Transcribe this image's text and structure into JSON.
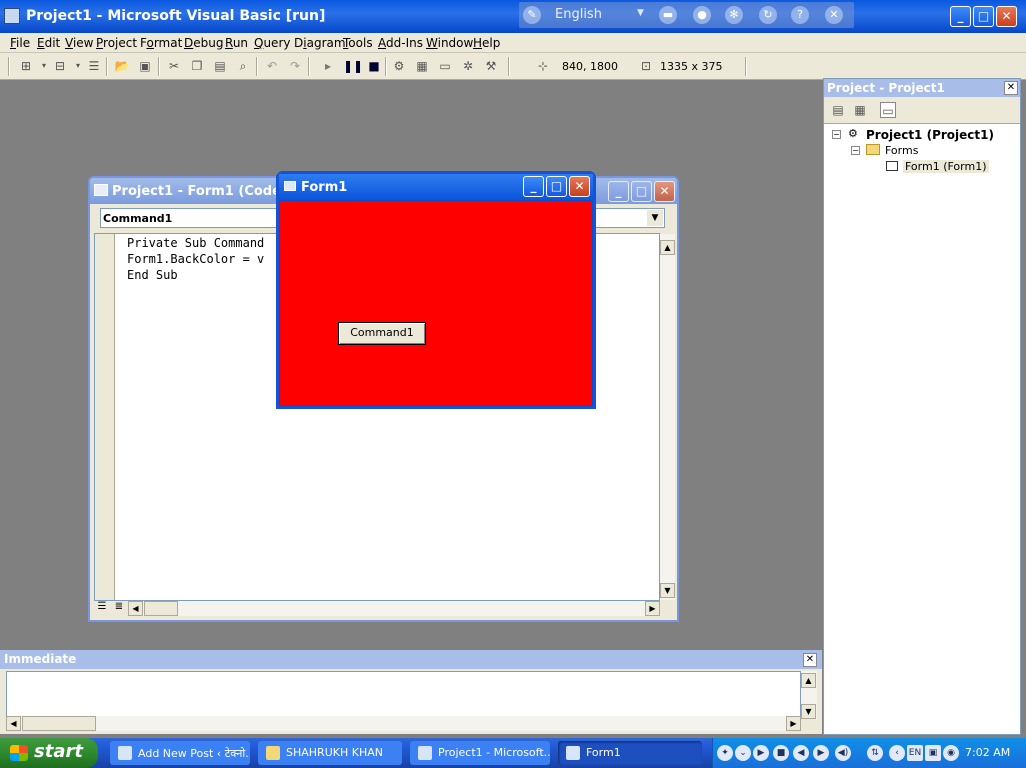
{
  "app": {
    "title": "Project1 - Microsoft Visual Basic [run]",
    "language_bar": {
      "language": "English"
    }
  },
  "menu": [
    {
      "label": "File",
      "u": "F",
      "rest": "ile"
    },
    {
      "label": "Edit",
      "u": "E",
      "rest": "dit"
    },
    {
      "label": "View",
      "u": "V",
      "rest": "iew"
    },
    {
      "label": "Project",
      "u": "P",
      "rest": "roject"
    },
    {
      "label": "Format",
      "u": "o",
      "pre": "F",
      "rest": "rmat"
    },
    {
      "label": "Debug",
      "u": "D",
      "rest": "ebug"
    },
    {
      "label": "Run",
      "u": "R",
      "rest": "un"
    },
    {
      "label": "Query",
      "u": "Q",
      "rest": "uery"
    },
    {
      "label": "Diagram",
      "u": "i",
      "pre": "D",
      "rest": "agram"
    },
    {
      "label": "Tools",
      "u": "T",
      "rest": "ools"
    },
    {
      "label": "Add-Ins",
      "u": "A",
      "rest": "dd-Ins"
    },
    {
      "label": "Window",
      "u": "W",
      "rest": "indow"
    },
    {
      "label": "Help",
      "u": "H",
      "rest": "elp"
    }
  ],
  "toolbar": {
    "position": "840, 1800",
    "size": "1335 x 375"
  },
  "code_window": {
    "title": "Project1 - Form1 (Code)",
    "object_combo": "Command1",
    "lines": [
      "Private Sub Command",
      "Form1.BackColor = v",
      "End Sub"
    ]
  },
  "form1": {
    "title": "Form1",
    "back_color": "#ff0000",
    "button_label": "Command1"
  },
  "project_explorer": {
    "title": "Project - Project1",
    "tree": {
      "project": "Project1 (Project1)",
      "folder": "Forms",
      "form": "Form1 (Form1)"
    }
  },
  "immediate": {
    "title": "Immediate"
  },
  "taskbar": {
    "start": "start",
    "tasks": [
      {
        "label": "Add New Post ‹ टेक्नो..."
      },
      {
        "label": "SHAHRUKH KHAN"
      },
      {
        "label": "Project1 - Microsoft..."
      },
      {
        "label": "Form1"
      }
    ],
    "clock": "7:02 AM"
  },
  "colors": {
    "xp_blue": "#0a58e0",
    "form_red": "#ff0000",
    "start_green": "#2f8a2f",
    "workspace_gray": "#808080"
  }
}
